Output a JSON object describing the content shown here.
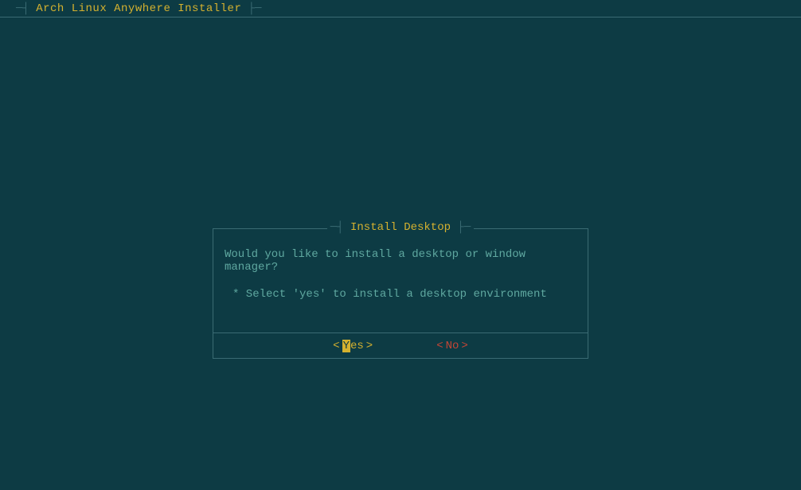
{
  "header": {
    "title": "Arch Linux Anywhere Installer"
  },
  "dialog": {
    "title": "Install Desktop",
    "question": "Would you like to install a desktop or window manager?",
    "hint": "* Select 'yes' to install a desktop environment",
    "buttons": {
      "yes_hotkey": "Y",
      "yes_rest": "es",
      "no": "No"
    }
  }
}
